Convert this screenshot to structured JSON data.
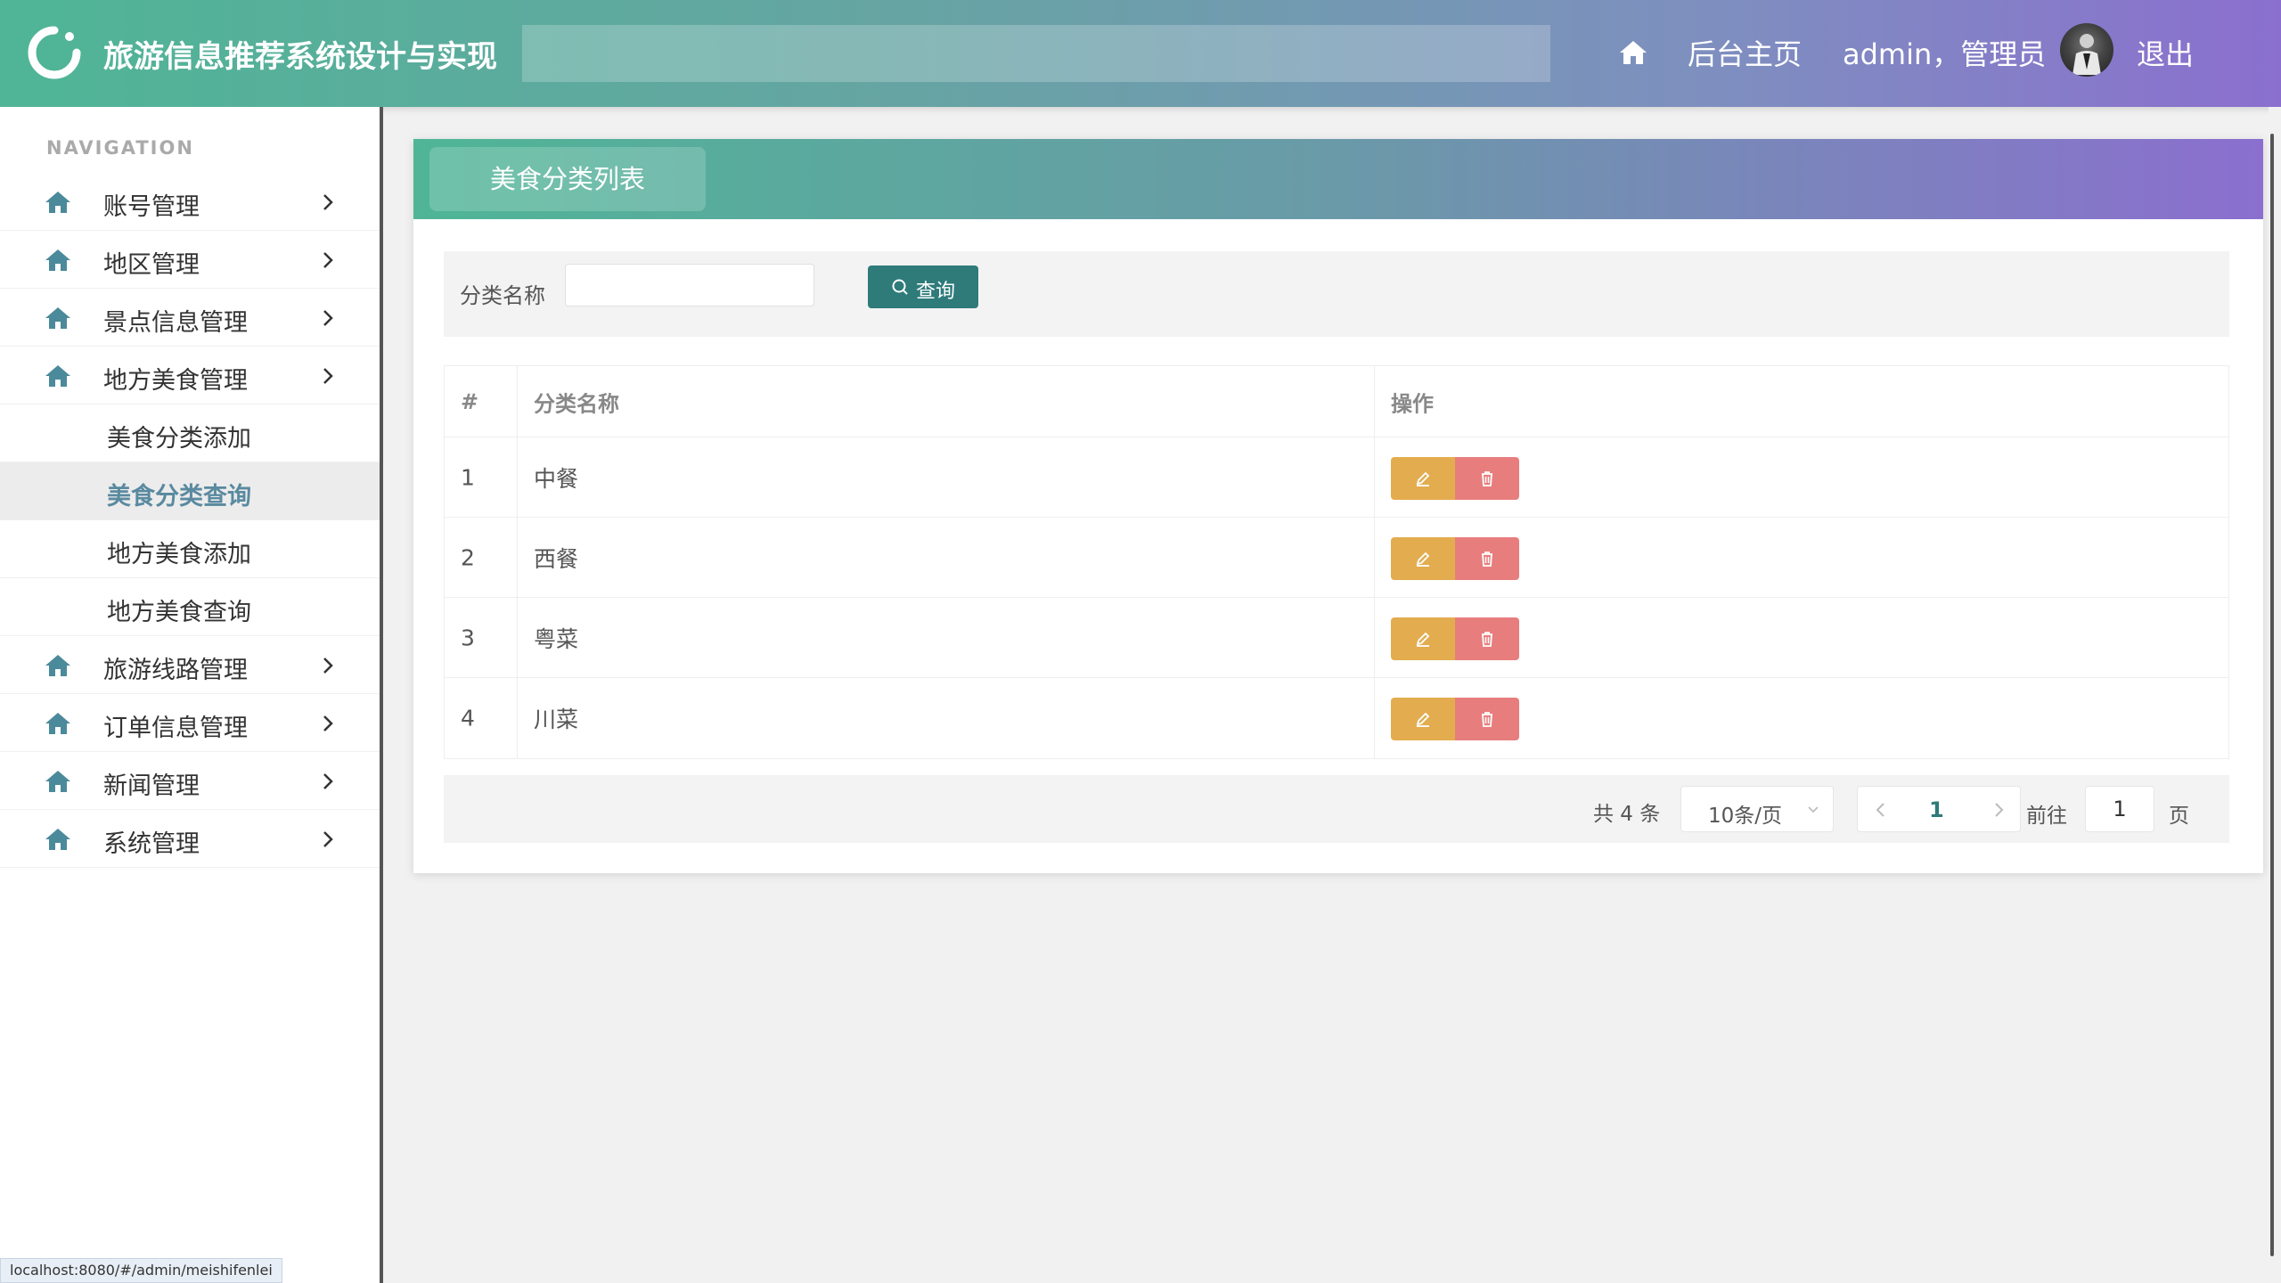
{
  "header": {
    "app_title": "旅游信息推荐系统设计与实现",
    "home_label": "后台主页",
    "user_label": "admin，管理员",
    "logout_label": "退出"
  },
  "sidebar": {
    "caption": "NAVIGATION",
    "items": [
      {
        "label": "账号管理"
      },
      {
        "label": "地区管理"
      },
      {
        "label": "景点信息管理"
      },
      {
        "label": "地方美食管理"
      },
      {
        "label": "旅游线路管理"
      },
      {
        "label": "订单信息管理"
      },
      {
        "label": "新闻管理"
      },
      {
        "label": "系统管理"
      }
    ],
    "subitems": [
      {
        "label": "美食分类添加"
      },
      {
        "label": "美食分类查询"
      },
      {
        "label": "地方美食添加"
      },
      {
        "label": "地方美食查询"
      }
    ],
    "active_subitem": "美食分类查询"
  },
  "card": {
    "title": "美食分类列表"
  },
  "search": {
    "label": "分类名称",
    "value": "",
    "button_label": "查询"
  },
  "table": {
    "columns": [
      "#",
      "分类名称",
      "操作"
    ],
    "rows": [
      {
        "index": "1",
        "name": "中餐"
      },
      {
        "index": "2",
        "name": "西餐"
      },
      {
        "index": "3",
        "name": "粤菜"
      },
      {
        "index": "4",
        "name": "川菜"
      }
    ]
  },
  "pagination": {
    "total_text": "共 4 条",
    "page_size": "10条/页",
    "current_page": "1",
    "goto_label": "前往",
    "goto_value": "1",
    "page_suffix": "页"
  },
  "status_bar": {
    "url": "localhost:8080/#/admin/meishifenlei"
  },
  "colors": {
    "accent": "#2e7b7a",
    "edit_button": "#e3ac4e",
    "delete_button": "#e87d7d",
    "active_nav_text": "#5a8aa0"
  },
  "icons": {
    "logo": "ring-logo-icon",
    "home": "home-icon",
    "chevron": "chevron-right-icon",
    "search": "search-icon",
    "edit": "pencil-icon",
    "delete": "trash-icon"
  }
}
